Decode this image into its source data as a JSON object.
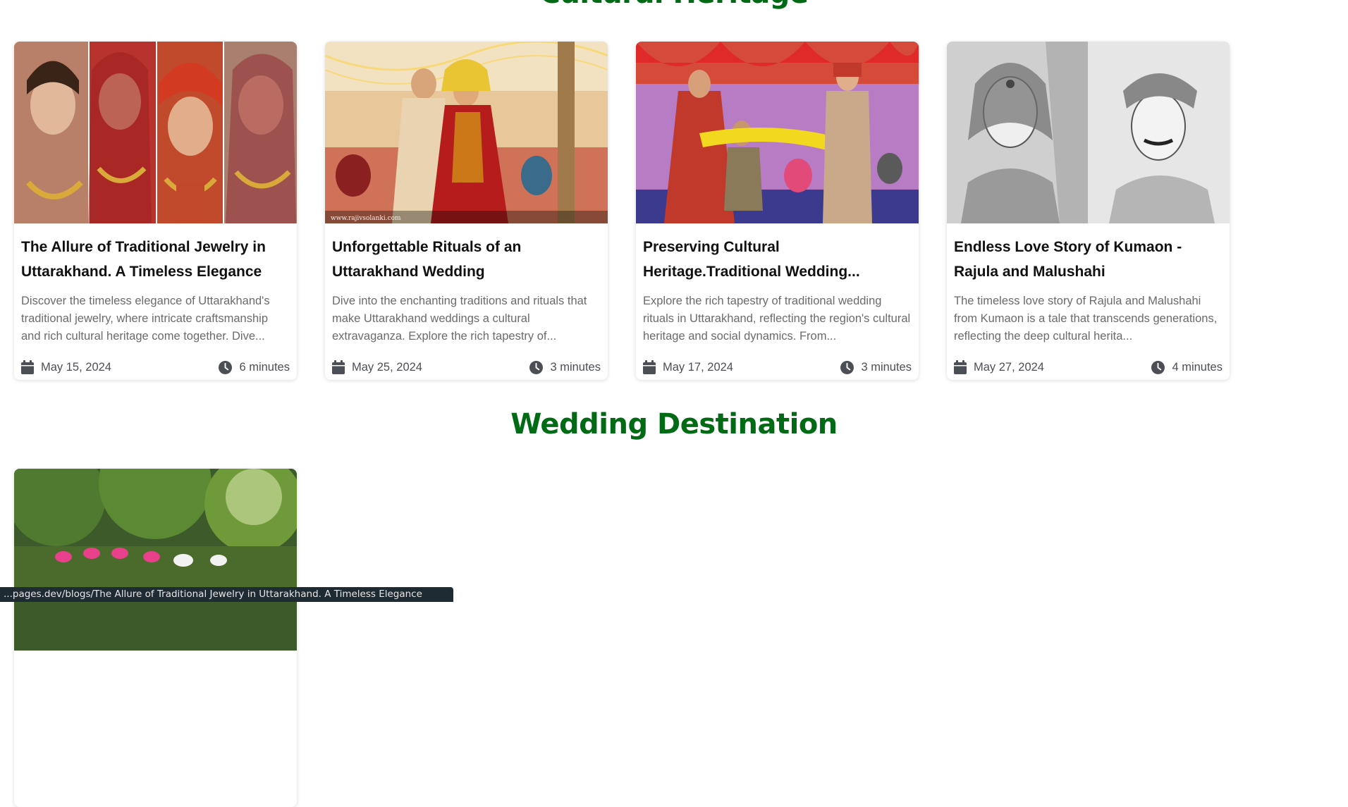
{
  "sections": {
    "heritage": {
      "title": "Cultural Heritage"
    },
    "wedding": {
      "title": "Wedding Destination"
    }
  },
  "colors": {
    "section_title": "#006b14",
    "status_bar_bg": "#1f2b33"
  },
  "heritage_posts": [
    {
      "title": "The Allure of Traditional Jewelry in Uttarakhand. A Timeless Elegance",
      "excerpt": "Discover the timeless elegance of Uttarakhand's traditional jewelry, where intricate craftsmanship and rich cultural heritage come together. Dive...",
      "date": "May 15, 2024",
      "read_time": "6 minutes",
      "image": "bridal-jewelry-collage"
    },
    {
      "title": "Unforgettable Rituals of an Uttarakhand Wedding",
      "excerpt": "Dive into the enchanting traditions and rituals that make Uttarakhand weddings a cultural extravaganza. Explore the rich tapestry of...",
      "date": "May 25, 2024",
      "read_time": "3 minutes",
      "image": "wedding-ritual-photo",
      "watermark": "www.rajivsolanki.com"
    },
    {
      "title": "Preserving Cultural Heritage.Traditional Wedding...",
      "excerpt": "Explore the rich tapestry of traditional wedding rituals in Uttarakhand, reflecting the region's cultural heritage and social dynamics. From...",
      "date": "May 17, 2024",
      "read_time": "3 minutes",
      "image": "wedding-ceremony-photo"
    },
    {
      "title": "Endless Love Story of Kumaon - Rajula and Malushahi",
      "excerpt": "The timeless love story of Rajula and Malushahi from Kumaon is a tale that transcends generations, reflecting the deep cultural herita...",
      "date": "May 27, 2024",
      "read_time": "4 minutes",
      "image": "sketch-portrait-pair"
    }
  ],
  "wedding_posts": [
    {
      "image": "outdoor-baraat-photo"
    }
  ],
  "icons": {
    "date": "calendar-icon",
    "time": "clock-icon"
  },
  "status_bar": {
    "url": "...pages.dev/blogs/The Allure of Traditional Jewelry in Uttarakhand. A Timeless Elegance"
  }
}
